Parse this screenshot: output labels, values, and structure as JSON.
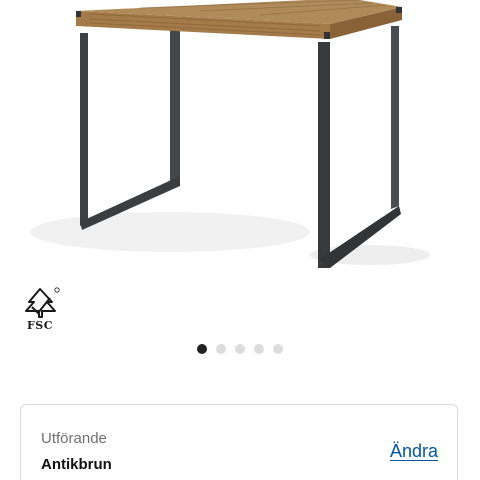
{
  "product": {
    "image_alt": "Table with rustic wooden top and black metal frame",
    "certification": {
      "icon": "fsc-tree-icon",
      "label": "FSC"
    }
  },
  "carousel": {
    "total": 5,
    "active_index": 0
  },
  "variant": {
    "label": "Utförande",
    "value": "Antikbrun",
    "change_label": "Ändra"
  },
  "colors": {
    "link": "#0058a3",
    "dot_active": "#222222",
    "dot_inactive": "#dcdcdc",
    "border": "#dadada"
  }
}
